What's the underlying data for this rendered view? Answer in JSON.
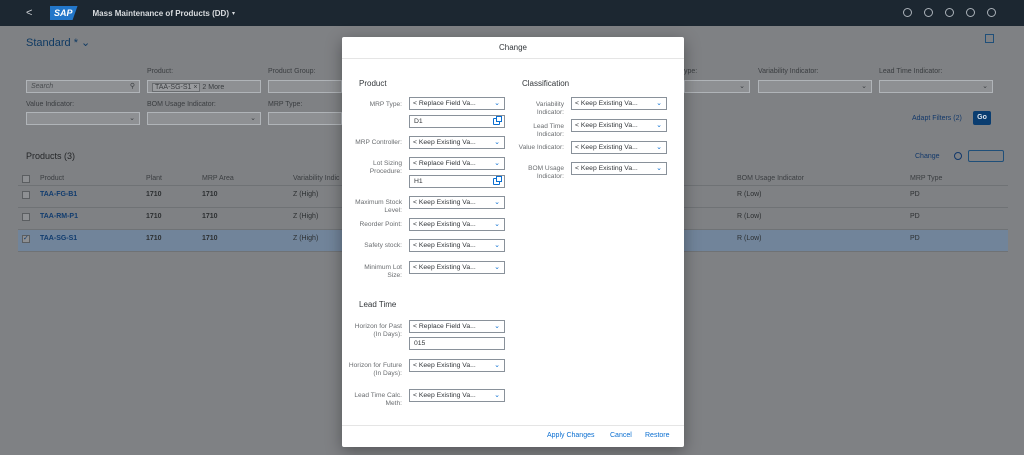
{
  "shell": {
    "back": "<",
    "logo": "SAP",
    "title": "Mass Maintenance of Products (DD)",
    "caret": "▾"
  },
  "page": {
    "variant": "Standard *",
    "variant_caret": "⌄",
    "filters": {
      "search_placeholder": "Search",
      "product_label": "Product:",
      "product_token": "TAA-SG-S1 ×",
      "product_more": "2 More",
      "product_group_label": "Product Group:",
      "type_label": "ype:",
      "variability_label": "Variability Indicator:",
      "lead_time_label": "Lead Time Indicator:",
      "value_label": "Value Indicator:",
      "bom_label": "BOM Usage Indicator:",
      "mrp_type_label": "MRP Type:"
    },
    "adapt_filters": "Adapt Filters (2)",
    "go": "Go",
    "table_title": "Products (3)",
    "change": "Change",
    "columns": [
      "Product",
      "Plant",
      "MRP Area",
      "Variability Indic",
      "BOM Usage Indicator",
      "MRP Type"
    ],
    "rows": [
      {
        "product": "TAA-FG-B1",
        "plant": "1710",
        "mrp_area": "1710",
        "variability": "Z (High)",
        "bom": "R (Low)",
        "mrp_type": "PD",
        "selected": false
      },
      {
        "product": "TAA-RM-P1",
        "plant": "1710",
        "mrp_area": "1710",
        "variability": "Z (High)",
        "bom": "R (Low)",
        "mrp_type": "PD",
        "selected": false
      },
      {
        "product": "TAA-SG-S1",
        "plant": "1710",
        "mrp_area": "1710",
        "variability": "Z (High)",
        "bom": "R (Low)",
        "mrp_type": "PD",
        "selected": true
      }
    ]
  },
  "dialog": {
    "title": "Change",
    "product_section": "Product",
    "classification_section": "Classification",
    "lead_time_section": "Lead Time",
    "fields": {
      "mrp_type_label": "MRP Type:",
      "mrp_type_select": "< Replace Field Va...",
      "mrp_type_value": "D1",
      "mrp_controller_label": "MRP Controller:",
      "mrp_controller_select": "< Keep Existing Va...",
      "lot_sizing_label": "Lot Sizing Procedure:",
      "lot_sizing_select": "< Replace Field Va...",
      "lot_sizing_value": "H1",
      "max_stock_label": "Maximum Stock Level:",
      "max_stock_select": "< Keep Existing Va...",
      "reorder_label": "Reorder Point:",
      "reorder_select": "< Keep Existing Va...",
      "safety_label": "Safety stock:",
      "safety_select": "< Keep Existing Va...",
      "min_lot_label": "Minimum Lot Size:",
      "min_lot_select": "< Keep Existing Va...",
      "variability_label": "Variability Indicator:",
      "variability_select": "< Keep Existing Va...",
      "lead_time_ind_label": "Lead Time Indicator:",
      "lead_time_ind_select": "< Keep Existing Va...",
      "value_ind_label": "Value Indicator:",
      "value_ind_select": "< Keep Existing Va...",
      "bom_label": "BOM Usage Indicator:",
      "bom_select": "< Keep Existing Va...",
      "horizon_past_label": "Horizon for Past (In Days):",
      "horizon_past_select": "< Replace Field Va...",
      "horizon_past_value": "015",
      "horizon_future_label": "Horizon for Future (In Days):",
      "horizon_future_select": "< Keep Existing Va...",
      "lead_calc_label": "Lead Time Calc. Meth:",
      "lead_calc_select": "< Keep Existing Va..."
    },
    "chevron": "⌄",
    "apply": "Apply Changes",
    "cancel": "Cancel",
    "restore": "Restore"
  }
}
